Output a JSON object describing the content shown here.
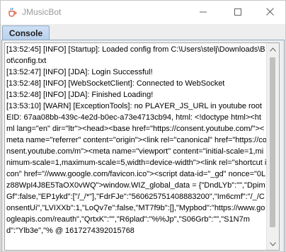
{
  "window": {
    "title": "JMusicBot",
    "icon": "java-cup-icon",
    "controls": {
      "minimize": "minimize-icon",
      "maximize": "maximize-icon",
      "close": "close-icon"
    }
  },
  "tabs": [
    {
      "label": "Console",
      "selected": true
    }
  ],
  "console": {
    "text": "[13:52:45] [INFO] [Startup]: Loaded config from C:\\Users\\stelj\\Downloads\\Bot\\config.txt\n[13:52:47] [INFO] [JDA]: Login Successful!\n[13:52:48] [INFO] [WebSocketClient]: Connected to WebSocket\n[13:52:48] [INFO] [JDA]: Finished Loading!\n[13:53:10] [WARN] [ExceptionTools]: no PLAYER_JS_URL in youtube root EID: 67aa08bb-439c-4e2d-b0ec-a73e4713cb94, html: <!doctype html><html lang=\"en\" dir=\"ltr\"><head><base href=\"https://consent.youtube.com/\"><meta name=\"referrer\" content=\"origin\"><link rel=\"canonical\" href=\"https://consent.youtube.com/m\"><meta name=\"viewport\" content=\"initial-scale=1,minimum-scale=1,maximum-scale=5,width=device-width\"><link rel=\"shortcut icon\" href=\"//www.google.com/favicon.ico\"><script data-id=\"_gd\" nonce=\"0Lz88WpI4J8E5TaOX0vWQ\">window.WIZ_global_data = {\"DndLYb\":\"\",\"DpimGf\":false,\"EP1ykd\":[\"/_/*\"],\"FdrFJe\":\"560625751408883200\",\"Im6cmf\":\"/_/ConsentUi\",\"LVIXXb\":1,\"LoQv7e\":false,\"MT7f9b\":[],\"Mypbod\":\"https://www.googleapis.com/reauth\",\"QrtxK\":\"\",\"R6plad\":\"%%Jp\",\"S06Grb\":\"\",\"S1N7md\":\"Ylb3e\",\"% @ 1617274392015768"
  }
}
